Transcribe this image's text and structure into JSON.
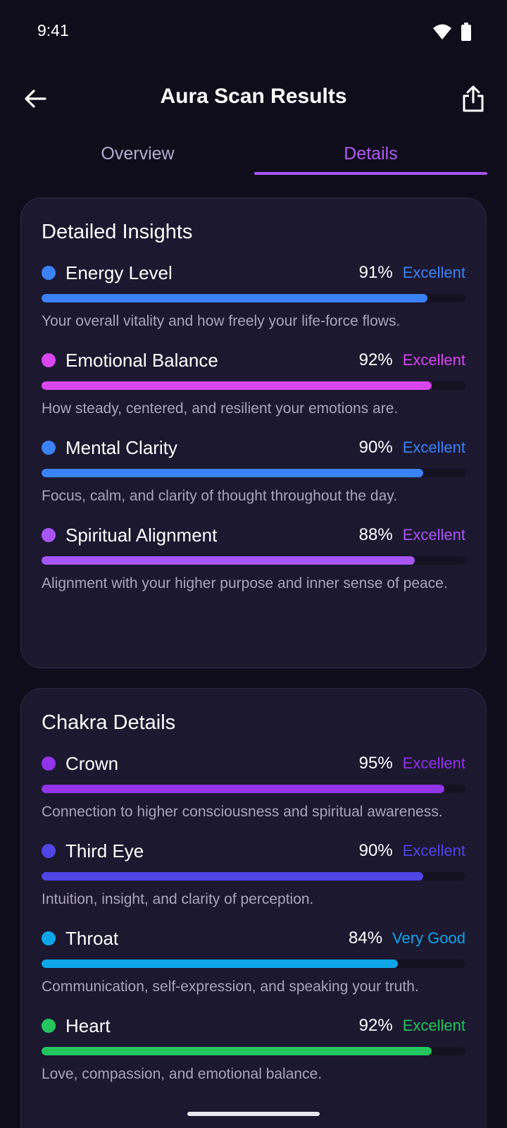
{
  "status": {
    "time": "9:41"
  },
  "app_bar": {
    "title": "Aura Scan Results"
  },
  "tabs": [
    {
      "label": "Overview",
      "active": false
    },
    {
      "label": "Details",
      "active": true
    }
  ],
  "insights": {
    "title": "Detailed Insights",
    "items": [
      {
        "name": "Energy Level",
        "percent": "91%",
        "value": 0.91,
        "rating": "Excellent",
        "color": "#3b82f6",
        "desc": "Your overall vitality and how freely your life-force flows."
      },
      {
        "name": "Emotional Balance",
        "percent": "92%",
        "value": 0.92,
        "rating": "Excellent",
        "color": "#d946ef",
        "desc": "How steady, centered, and resilient your emotions are."
      },
      {
        "name": "Mental Clarity",
        "percent": "90%",
        "value": 0.9,
        "rating": "Excellent",
        "color": "#3b82f6",
        "desc": "Focus, calm, and clarity of thought throughout the day."
      },
      {
        "name": "Spiritual Alignment",
        "percent": "88%",
        "value": 0.88,
        "rating": "Excellent",
        "color": "#a855f7",
        "desc": "Alignment with your higher purpose and inner sense of peace."
      }
    ]
  },
  "chakras": {
    "title": "Chakra Details",
    "items": [
      {
        "name": "Crown",
        "percent": "95%",
        "value": 0.95,
        "rating": "Excellent",
        "color": "#9333ea",
        "desc": "Connection to higher consciousness and spiritual awareness."
      },
      {
        "name": "Third Eye",
        "percent": "90%",
        "value": 0.9,
        "rating": "Excellent",
        "color": "#4f46e5",
        "desc": "Intuition, insight, and clarity of perception."
      },
      {
        "name": "Throat",
        "percent": "84%",
        "value": 0.84,
        "rating": "Very Good",
        "color": "#0ea5e9",
        "desc": "Communication, self-expression, and speaking your truth."
      },
      {
        "name": "Heart",
        "percent": "92%",
        "value": 0.92,
        "rating": "Excellent",
        "color": "#22c55e",
        "desc": "Love, compassion, and emotional balance."
      }
    ]
  }
}
